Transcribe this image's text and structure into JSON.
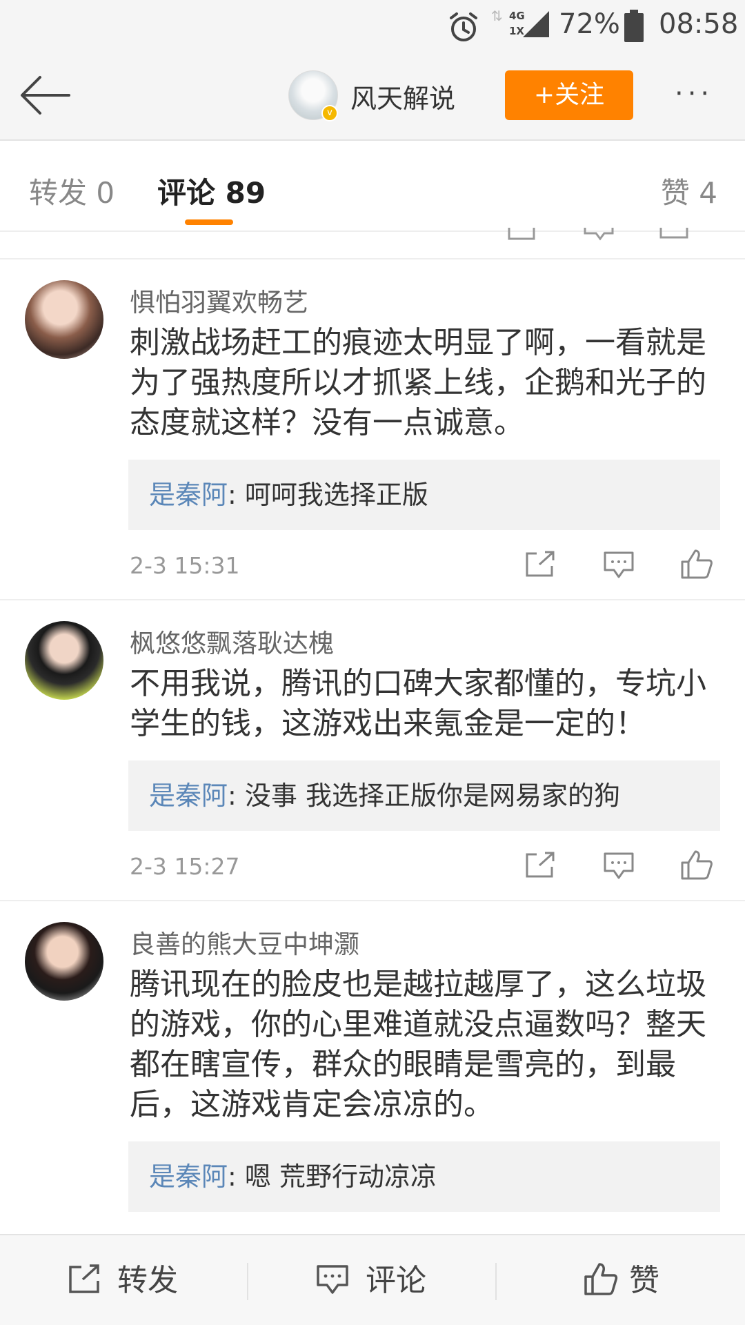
{
  "status_bar": {
    "network": "4G",
    "network_sub": "1X",
    "battery_percent": "72%",
    "time": "08:58"
  },
  "header": {
    "title": "风天解说",
    "follow_label": "+关注",
    "more_label": "···"
  },
  "tabs": {
    "repost": "转发 0",
    "comment": "评论 89",
    "like": "赞 4"
  },
  "comments": [
    {
      "username": "惧怕羽翼欢畅艺",
      "text": "刺激战场赶工的痕迹太明显了啊，一看就是为了强热度所以才抓紧上线，企鹅和光子的态度就这样？没有一点诚意。",
      "reply_name": "是秦阿",
      "reply_text": ": 呵呵我选择正版",
      "date": "2-3 15:31"
    },
    {
      "username": "枫悠悠飘落耿达槐",
      "text": "不用我说，腾讯的口碑大家都懂的，专坑小学生的钱，这游戏出来氪金是一定的！",
      "reply_name": "是秦阿",
      "reply_text": ": 没事 我选择正版你是网易家的狗",
      "date": "2-3 15:27"
    },
    {
      "username": "良善的熊大豆中坤灏",
      "text": "腾讯现在的脸皮也是越拉越厚了，这么垃圾的游戏，你的心里难道就没点逼数吗？整天都在瞎宣传，群众的眼睛是雪亮的，到最后，这游戏肯定会凉凉的。",
      "reply_name": "是秦阿",
      "reply_text": ": 嗯 荒野行动凉凉"
    }
  ],
  "bottom_bar": {
    "repost": "转发",
    "comment": "评论",
    "like": "赞"
  },
  "icons": {
    "back": "back-arrow-icon",
    "repost": "share-icon",
    "comment": "comment-icon",
    "like": "thumbs-up-icon",
    "alarm": "alarm-icon",
    "battery": "battery-icon",
    "signal": "signal-icon"
  },
  "colors": {
    "accent": "#ff8200",
    "reply_name": "#5b87b8"
  }
}
